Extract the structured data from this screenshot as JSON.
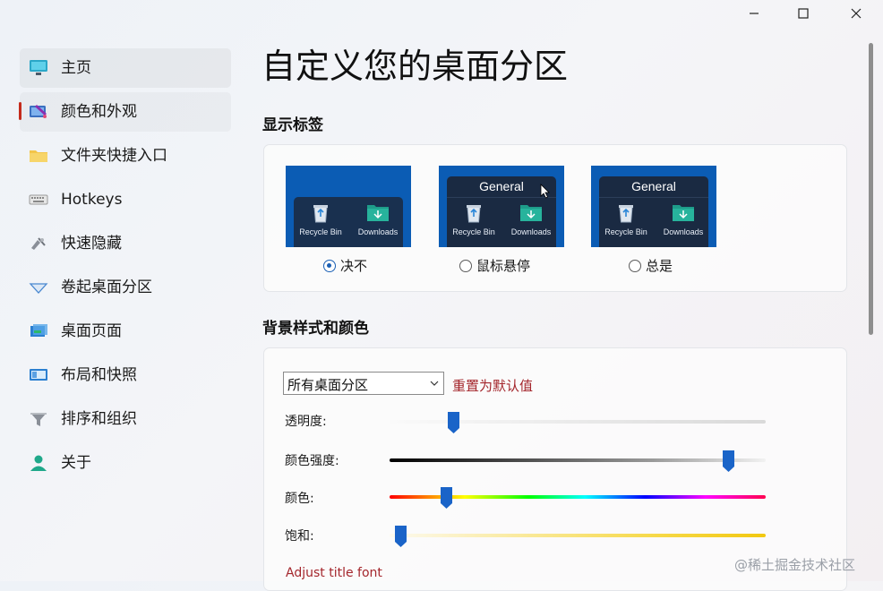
{
  "window": {
    "buttons": {
      "minimize": "minimize-icon",
      "maximize": "maximize-icon",
      "close": "close-icon"
    }
  },
  "sidebar": {
    "selected_index": 1,
    "accent_color": "#c42b1c",
    "items": [
      {
        "label": "主页",
        "icon": "monitor-icon"
      },
      {
        "label": "颜色和外观",
        "icon": "paint-monitor-icon"
      },
      {
        "label": "文件夹快捷入口",
        "icon": "folder-icon"
      },
      {
        "label": "Hotkeys",
        "icon": "keyboard-icon"
      },
      {
        "label": "快速隐藏",
        "icon": "hide-icon"
      },
      {
        "label": "卷起桌面分区",
        "icon": "rollup-icon"
      },
      {
        "label": "桌面页面",
        "icon": "pages-icon"
      },
      {
        "label": "布局和快照",
        "icon": "layout-icon"
      },
      {
        "label": "排序和组织",
        "icon": "funnel-icon"
      },
      {
        "label": "关于",
        "icon": "person-icon"
      }
    ]
  },
  "main": {
    "title": "自定义您的桌面分区",
    "labels_section": {
      "heading": "显示标签",
      "options": [
        {
          "label": "决不",
          "selected": true,
          "fence_title": ""
        },
        {
          "label": "鼠标悬停",
          "selected": false,
          "fence_title": "General"
        },
        {
          "label": "总是",
          "selected": false,
          "fence_title": "General"
        }
      ],
      "preview_icons": [
        "Recycle Bin",
        "Downloads"
      ]
    },
    "background_section": {
      "heading": "背景样式和颜色",
      "dropdown_value": "所有桌面分区",
      "reset_link": "重置为默认值",
      "sliders": [
        {
          "label": "透明度:",
          "value": 0.17
        },
        {
          "label": "颜色强度:",
          "value": 0.9
        },
        {
          "label": "颜色:",
          "value": 0.15
        },
        {
          "label": "饱和:",
          "value": 0.03
        }
      ],
      "adjust_title_font_link": "Adjust title font"
    }
  },
  "watermark": "@稀土掘金技术社区",
  "colors": {
    "preview_bg": "#0b5cb4",
    "link": "#a4262c",
    "slider_thumb": "#1a64c8"
  }
}
